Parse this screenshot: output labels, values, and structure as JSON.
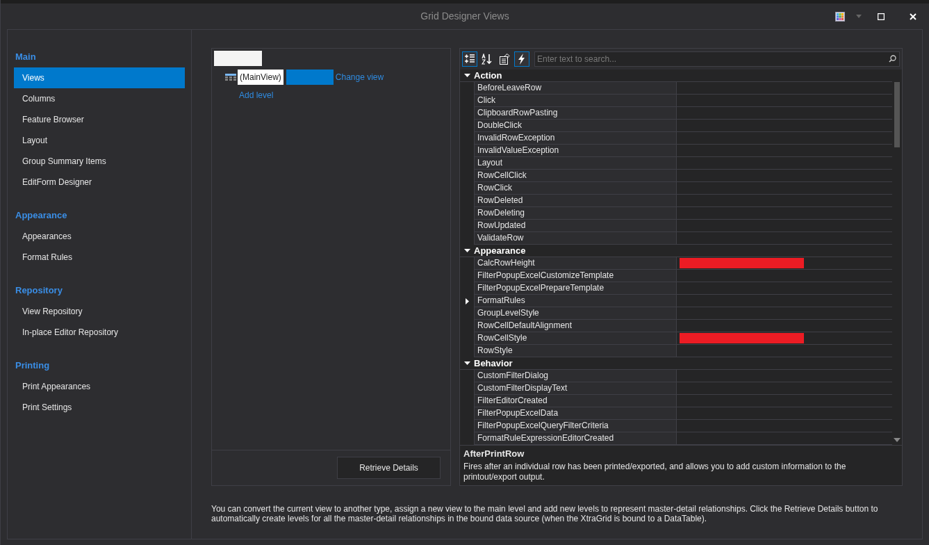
{
  "window": {
    "title": "Grid Designer Views"
  },
  "sidebar": {
    "groups": [
      {
        "title": "Main",
        "items": [
          {
            "label": "Views",
            "selected": true
          },
          {
            "label": "Columns",
            "selected": false
          },
          {
            "label": "Feature Browser",
            "selected": false
          },
          {
            "label": "Layout",
            "selected": false
          },
          {
            "label": "Group Summary Items",
            "selected": false
          },
          {
            "label": "EditForm Designer",
            "selected": false
          }
        ]
      },
      {
        "title": "Appearance",
        "items": [
          {
            "label": "Appearances",
            "selected": false
          },
          {
            "label": "Format Rules",
            "selected": false
          }
        ]
      },
      {
        "title": "Repository",
        "items": [
          {
            "label": "View Repository",
            "selected": false
          },
          {
            "label": "In-place Editor Repository",
            "selected": false
          }
        ]
      },
      {
        "title": "Printing",
        "items": [
          {
            "label": "Print Appearances",
            "selected": false
          },
          {
            "label": "Print Settings",
            "selected": false
          }
        ]
      }
    ]
  },
  "levels": {
    "main_view": "(MainView)",
    "change_view": "Change view",
    "add_level": "Add level",
    "retrieve_button": "Retrieve Details"
  },
  "property_grid": {
    "toolbar": [
      {
        "kind": "categorized",
        "selected": true
      },
      {
        "kind": "alphabetical",
        "selected": false
      },
      {
        "kind": "properties",
        "selected": false
      },
      {
        "kind": "events",
        "selected": true
      }
    ],
    "search": {
      "placeholder": "Enter text to search..."
    },
    "categories": [
      {
        "name": "Action",
        "expanded": true,
        "rows": [
          {
            "name": "BeforeLeaveRow"
          },
          {
            "name": "Click"
          },
          {
            "name": "ClipboardRowPasting"
          },
          {
            "name": "DoubleClick"
          },
          {
            "name": "InvalidRowException"
          },
          {
            "name": "InvalidValueException"
          },
          {
            "name": "Layout"
          },
          {
            "name": "RowCellClick"
          },
          {
            "name": "RowClick"
          },
          {
            "name": "RowDeleted"
          },
          {
            "name": "RowDeleting"
          },
          {
            "name": "RowUpdated"
          },
          {
            "name": "ValidateRow"
          }
        ]
      },
      {
        "name": "Appearance",
        "expanded": true,
        "rows": [
          {
            "name": "CalcRowHeight",
            "redacted": true
          },
          {
            "name": "FilterPopupExcelCustomizeTemplate"
          },
          {
            "name": "FilterPopupExcelPrepareTemplate"
          },
          {
            "name": "FormatRules",
            "expandable": true
          },
          {
            "name": "GroupLevelStyle"
          },
          {
            "name": "RowCellDefaultAlignment"
          },
          {
            "name": "RowCellStyle",
            "redacted": true
          },
          {
            "name": "RowStyle"
          }
        ]
      },
      {
        "name": "Behavior",
        "expanded": true,
        "rows": [
          {
            "name": "CustomFilterDialog"
          },
          {
            "name": "CustomFilterDisplayText"
          },
          {
            "name": "FilterEditorCreated"
          },
          {
            "name": "FilterPopupExcelData"
          },
          {
            "name": "FilterPopupExcelQueryFilterCriteria"
          },
          {
            "name": "FormatRuleExpressionEditorCreated"
          }
        ]
      }
    ],
    "description": {
      "title": "AfterPrintRow",
      "text": "Fires after an individual row has been printed/exported, and allows you to add custom information to the printout/export output."
    }
  },
  "footer_text": "You can convert the current view to another type, assign a new view to the main level and add new levels to represent master-detail relationships. Click the Retrieve Details button to automatically create levels for all the master-detail relationships in the bound data source (when the XtraGrid is bound to a DataTable)."
}
